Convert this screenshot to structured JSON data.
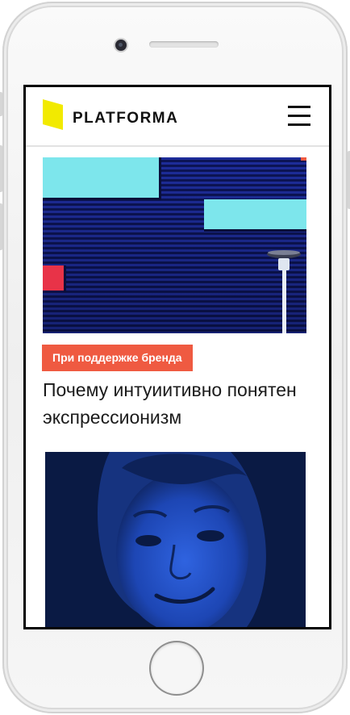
{
  "app": {
    "logo_text": "PLATFORMA",
    "logo_color": "#f2ea00",
    "menu_icon": "hamburger-icon"
  },
  "articles": [
    {
      "image_desc": "blue-striped-wall-photo",
      "badge": "При поддержке бренда",
      "badge_color": "#ef5a41",
      "title": "Почему интуиитивно понятен экспрессионизм"
    },
    {
      "image_desc": "blue-portrait-photo"
    }
  ],
  "colors": {
    "wall_blue": "#1f2f9c",
    "panel_cyan": "#7de6ec",
    "panel_red": "#e83348",
    "portrait_blue": "#1b46b8"
  }
}
